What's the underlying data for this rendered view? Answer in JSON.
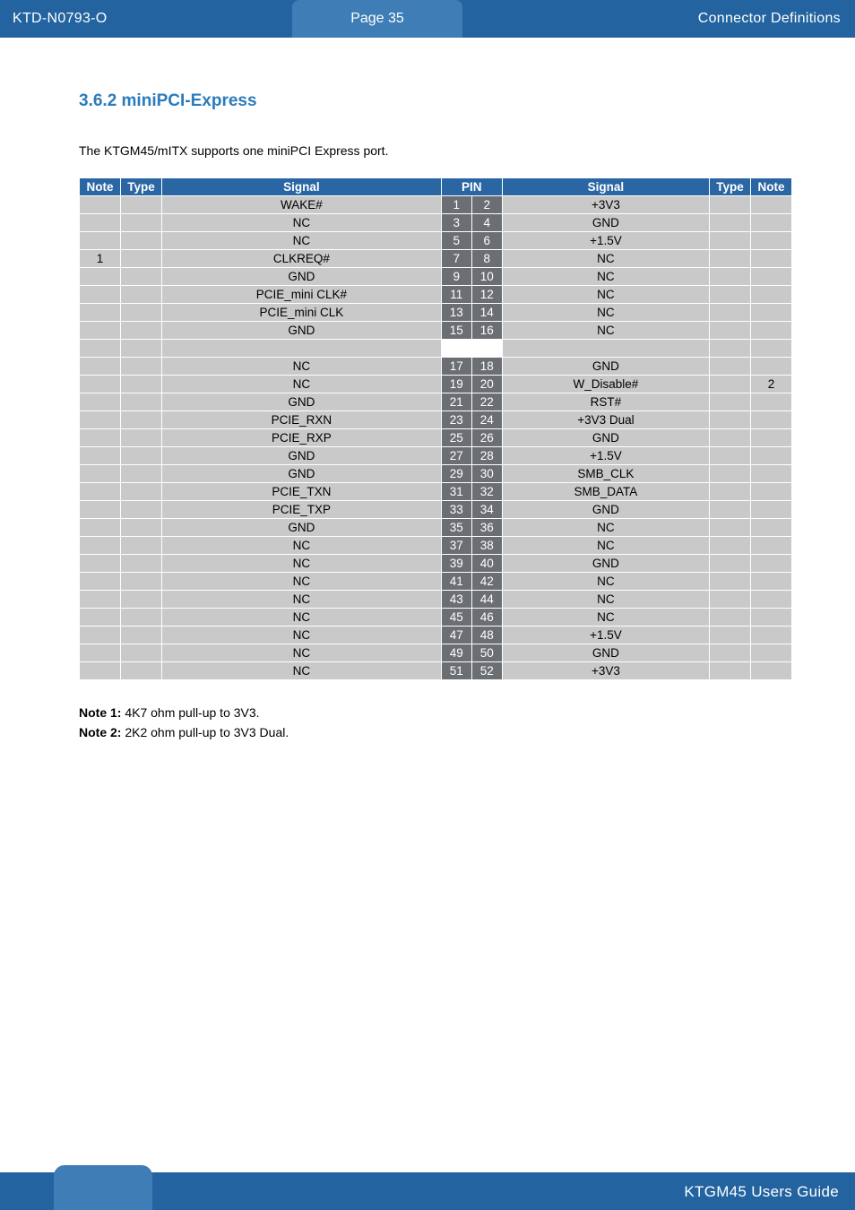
{
  "header": {
    "doc_id": "KTD-N0793-O",
    "page_label": "Page 35",
    "section_label": "Connector Definitions"
  },
  "section": {
    "number_title": "3.6.2  miniPCI-Express",
    "intro": "The KTGM45/mITX supports one miniPCI Express port."
  },
  "table": {
    "headers": {
      "note_l": "Note",
      "type_l": "Type",
      "signal_l": "Signal",
      "pin": "PIN",
      "signal_r": "Signal",
      "type_r": "Type",
      "note_r": "Note"
    },
    "rows": [
      {
        "nl": "",
        "tl": "",
        "sl": "WAKE#",
        "p1": "1",
        "p2": "2",
        "sr": "+3V3",
        "tr": "",
        "nr": ""
      },
      {
        "nl": "",
        "tl": "",
        "sl": "NC",
        "p1": "3",
        "p2": "4",
        "sr": "GND",
        "tr": "",
        "nr": ""
      },
      {
        "nl": "",
        "tl": "",
        "sl": "NC",
        "p1": "5",
        "p2": "6",
        "sr": "+1.5V",
        "tr": "",
        "nr": ""
      },
      {
        "nl": "1",
        "tl": "",
        "sl": "CLKREQ#",
        "p1": "7",
        "p2": "8",
        "sr": "NC",
        "tr": "",
        "nr": ""
      },
      {
        "nl": "",
        "tl": "",
        "sl": "GND",
        "p1": "9",
        "p2": "10",
        "sr": "NC",
        "tr": "",
        "nr": ""
      },
      {
        "nl": "",
        "tl": "",
        "sl": "PCIE_mini CLK#",
        "p1": "11",
        "p2": "12",
        "sr": "NC",
        "tr": "",
        "nr": ""
      },
      {
        "nl": "",
        "tl": "",
        "sl": "PCIE_mini CLK",
        "p1": "13",
        "p2": "14",
        "sr": "NC",
        "tr": "",
        "nr": ""
      },
      {
        "nl": "",
        "tl": "",
        "sl": "GND",
        "p1": "15",
        "p2": "16",
        "sr": "NC",
        "tr": "",
        "nr": ""
      },
      {
        "spacer": true
      },
      {
        "nl": "",
        "tl": "",
        "sl": "NC",
        "p1": "17",
        "p2": "18",
        "sr": "GND",
        "tr": "",
        "nr": ""
      },
      {
        "nl": "",
        "tl": "",
        "sl": "NC",
        "p1": "19",
        "p2": "20",
        "sr": "W_Disable#",
        "tr": "",
        "nr": "2"
      },
      {
        "nl": "",
        "tl": "",
        "sl": "GND",
        "p1": "21",
        "p2": "22",
        "sr": "RST#",
        "tr": "",
        "nr": ""
      },
      {
        "nl": "",
        "tl": "",
        "sl": "PCIE_RXN",
        "p1": "23",
        "p2": "24",
        "sr": "+3V3 Dual",
        "tr": "",
        "nr": ""
      },
      {
        "nl": "",
        "tl": "",
        "sl": "PCIE_RXP",
        "p1": "25",
        "p2": "26",
        "sr": "GND",
        "tr": "",
        "nr": ""
      },
      {
        "nl": "",
        "tl": "",
        "sl": "GND",
        "p1": "27",
        "p2": "28",
        "sr": "+1.5V",
        "tr": "",
        "nr": ""
      },
      {
        "nl": "",
        "tl": "",
        "sl": "GND",
        "p1": "29",
        "p2": "30",
        "sr": "SMB_CLK",
        "tr": "",
        "nr": ""
      },
      {
        "nl": "",
        "tl": "",
        "sl": "PCIE_TXN",
        "p1": "31",
        "p2": "32",
        "sr": "SMB_DATA",
        "tr": "",
        "nr": ""
      },
      {
        "nl": "",
        "tl": "",
        "sl": "PCIE_TXP",
        "p1": "33",
        "p2": "34",
        "sr": "GND",
        "tr": "",
        "nr": ""
      },
      {
        "nl": "",
        "tl": "",
        "sl": "GND",
        "p1": "35",
        "p2": "36",
        "sr": "NC",
        "tr": "",
        "nr": ""
      },
      {
        "nl": "",
        "tl": "",
        "sl": "NC",
        "p1": "37",
        "p2": "38",
        "sr": "NC",
        "tr": "",
        "nr": ""
      },
      {
        "nl": "",
        "tl": "",
        "sl": "NC",
        "p1": "39",
        "p2": "40",
        "sr": "GND",
        "tr": "",
        "nr": ""
      },
      {
        "nl": "",
        "tl": "",
        "sl": "NC",
        "p1": "41",
        "p2": "42",
        "sr": "NC",
        "tr": "",
        "nr": ""
      },
      {
        "nl": "",
        "tl": "",
        "sl": "NC",
        "p1": "43",
        "p2": "44",
        "sr": "NC",
        "tr": "",
        "nr": ""
      },
      {
        "nl": "",
        "tl": "",
        "sl": "NC",
        "p1": "45",
        "p2": "46",
        "sr": "NC",
        "tr": "",
        "nr": ""
      },
      {
        "nl": "",
        "tl": "",
        "sl": "NC",
        "p1": "47",
        "p2": "48",
        "sr": "+1.5V",
        "tr": "",
        "nr": ""
      },
      {
        "nl": "",
        "tl": "",
        "sl": "NC",
        "p1": "49",
        "p2": "50",
        "sr": "GND",
        "tr": "",
        "nr": ""
      },
      {
        "nl": "",
        "tl": "",
        "sl": "NC",
        "p1": "51",
        "p2": "52",
        "sr": "+3V3",
        "tr": "",
        "nr": ""
      }
    ]
  },
  "notes": {
    "n1_label": "Note 1:",
    "n1_text": " 4K7 ohm pull-up to 3V3.",
    "n2_label": "Note 2:",
    "n2_text": " 2K2 ohm pull-up to 3V3 Dual."
  },
  "footer": {
    "guide": "KTGM45 Users Guide"
  }
}
